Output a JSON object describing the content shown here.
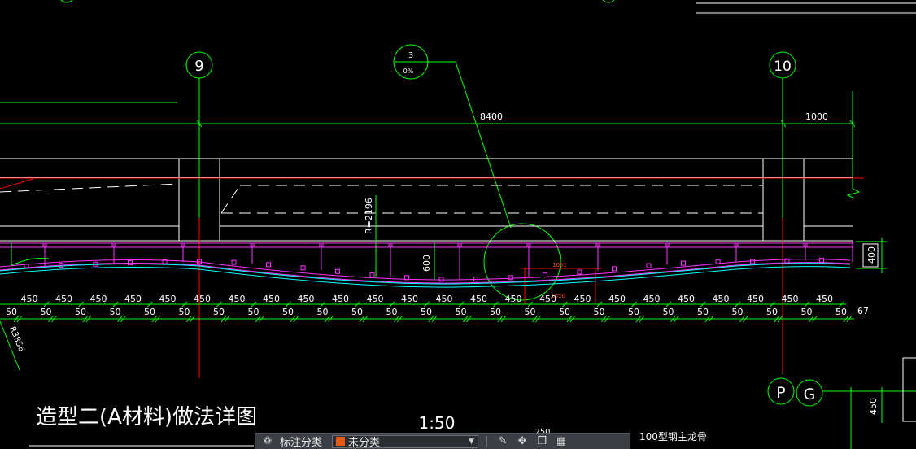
{
  "drawing": {
    "grid_markers": {
      "left": "9",
      "right": "10",
      "bottom_p": "P",
      "bottom_g": "G"
    },
    "detail_callout": {
      "number": "3",
      "sub": "0%"
    },
    "dims_top": {
      "span": "8400",
      "right": "1000"
    },
    "radius_label": "R=2196",
    "height_dim": "600",
    "side_dim": "400",
    "bottom_side_dim": "450",
    "small_dims": {
      "a": "1051",
      "b": "1050"
    },
    "diag_label": "R3856",
    "repeat_450": "450",
    "repeat_50": "50",
    "end_dim": "67",
    "title": "造型二(A材料)做法详图",
    "scale": "1:50",
    "keel_label": "100型钢主龙骨",
    "small_top": "250",
    "colors": {
      "background": "#000000",
      "green": "#00ff00",
      "white": "#ffffff",
      "red": "#ff0000",
      "magenta": "#ff33ff",
      "cyan": "#00ffff"
    }
  },
  "toolbar": {
    "annotation_label": "标注分类",
    "layer_value": "未分类",
    "layer_color": "#e85a12",
    "icons": [
      "match-icon",
      "edit-icon",
      "move-icon",
      "copy-icon",
      "layers-icon"
    ]
  }
}
